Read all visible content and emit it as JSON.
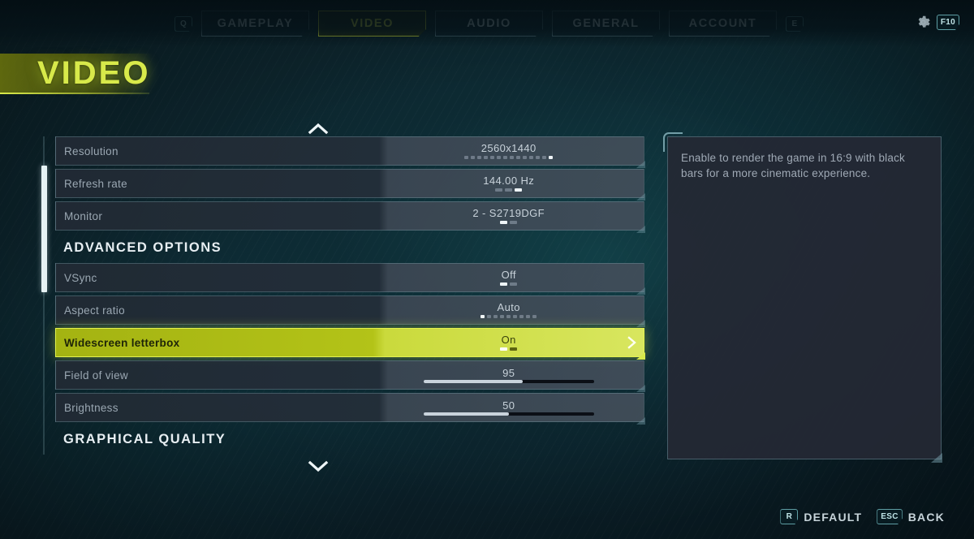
{
  "header": {
    "left_key": "Q",
    "right_key": "E",
    "settings_key": "F10",
    "gear_icon": "gear-icon",
    "tabs": [
      {
        "label": "GAMEPLAY",
        "active": false
      },
      {
        "label": "VIDEO",
        "active": true
      },
      {
        "label": "AUDIO",
        "active": false
      },
      {
        "label": "GENERAL",
        "active": false
      },
      {
        "label": "ACCOUNT",
        "active": false
      }
    ]
  },
  "page": {
    "title": "VIDEO",
    "scroll_up_icon": "chevron-up-icon",
    "scroll_down_icon": "chevron-down-icon"
  },
  "settings": [
    {
      "kind": "option",
      "label": "Resolution",
      "value": "2560x1440",
      "control": "steps",
      "steps_total": 14,
      "steps_index": 13,
      "selected": false
    },
    {
      "kind": "option",
      "label": "Refresh rate",
      "value": "144.00 Hz",
      "control": "steps",
      "steps_total": 3,
      "steps_index": 2,
      "selected": false
    },
    {
      "kind": "option",
      "label": "Monitor",
      "value": "2 - S2719DGF",
      "control": "steps",
      "steps_total": 2,
      "steps_index": 0,
      "selected": false
    },
    {
      "kind": "section",
      "label": "ADVANCED OPTIONS"
    },
    {
      "kind": "option",
      "label": "VSync",
      "value": "Off",
      "control": "steps",
      "steps_total": 2,
      "steps_index": 0,
      "selected": false
    },
    {
      "kind": "option",
      "label": "Aspect ratio",
      "value": "Auto",
      "control": "steps",
      "steps_total": 9,
      "steps_index": 0,
      "selected": false
    },
    {
      "kind": "option",
      "label": "Widescreen letterbox",
      "value": "On",
      "control": "steps",
      "steps_total": 2,
      "steps_index": 0,
      "selected": true,
      "chevron_icon": "chevron-right-icon"
    },
    {
      "kind": "option",
      "label": "Field of view",
      "value": "95",
      "control": "slider",
      "slider_percent": 58,
      "selected": false
    },
    {
      "kind": "option",
      "label": "Brightness",
      "value": "50",
      "control": "slider",
      "slider_percent": 50,
      "selected": false
    },
    {
      "kind": "section",
      "label": "GRAPHICAL QUALITY"
    }
  ],
  "info_panel": {
    "text": "Enable to render the game in 16:9 with black bars for a more cinematic experience."
  },
  "footer": {
    "hints": [
      {
        "key": "R",
        "label": "DEFAULT"
      },
      {
        "key": "ESC",
        "label": "BACK"
      }
    ]
  },
  "colors": {
    "accent": "#d8e94a",
    "background": "#0d2730",
    "row_fill": "#242e39",
    "panel": "#242834",
    "text_muted": "#9aa7b2"
  }
}
